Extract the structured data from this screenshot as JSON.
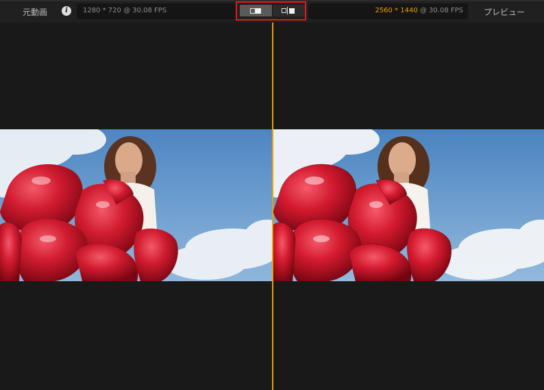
{
  "toolbar": {
    "left_label": "元動画",
    "info_icon_glyph": "i",
    "left_info": "1280 * 720 @ 30.08 FPS",
    "right_resolution": "2560 * 1440",
    "right_fps": " @ 30.08 FPS",
    "right_label": "プレビュー",
    "view_toggle": {
      "active_mode": "split",
      "modes": [
        "split-view-icon",
        "side-by-side-icon"
      ]
    }
  },
  "colors": {
    "accent": "#f0a000",
    "highlight_border": "#e01b1b",
    "background": "#191919"
  },
  "panes": {
    "original": "original video frame",
    "preview": "upscaled preview frame"
  }
}
